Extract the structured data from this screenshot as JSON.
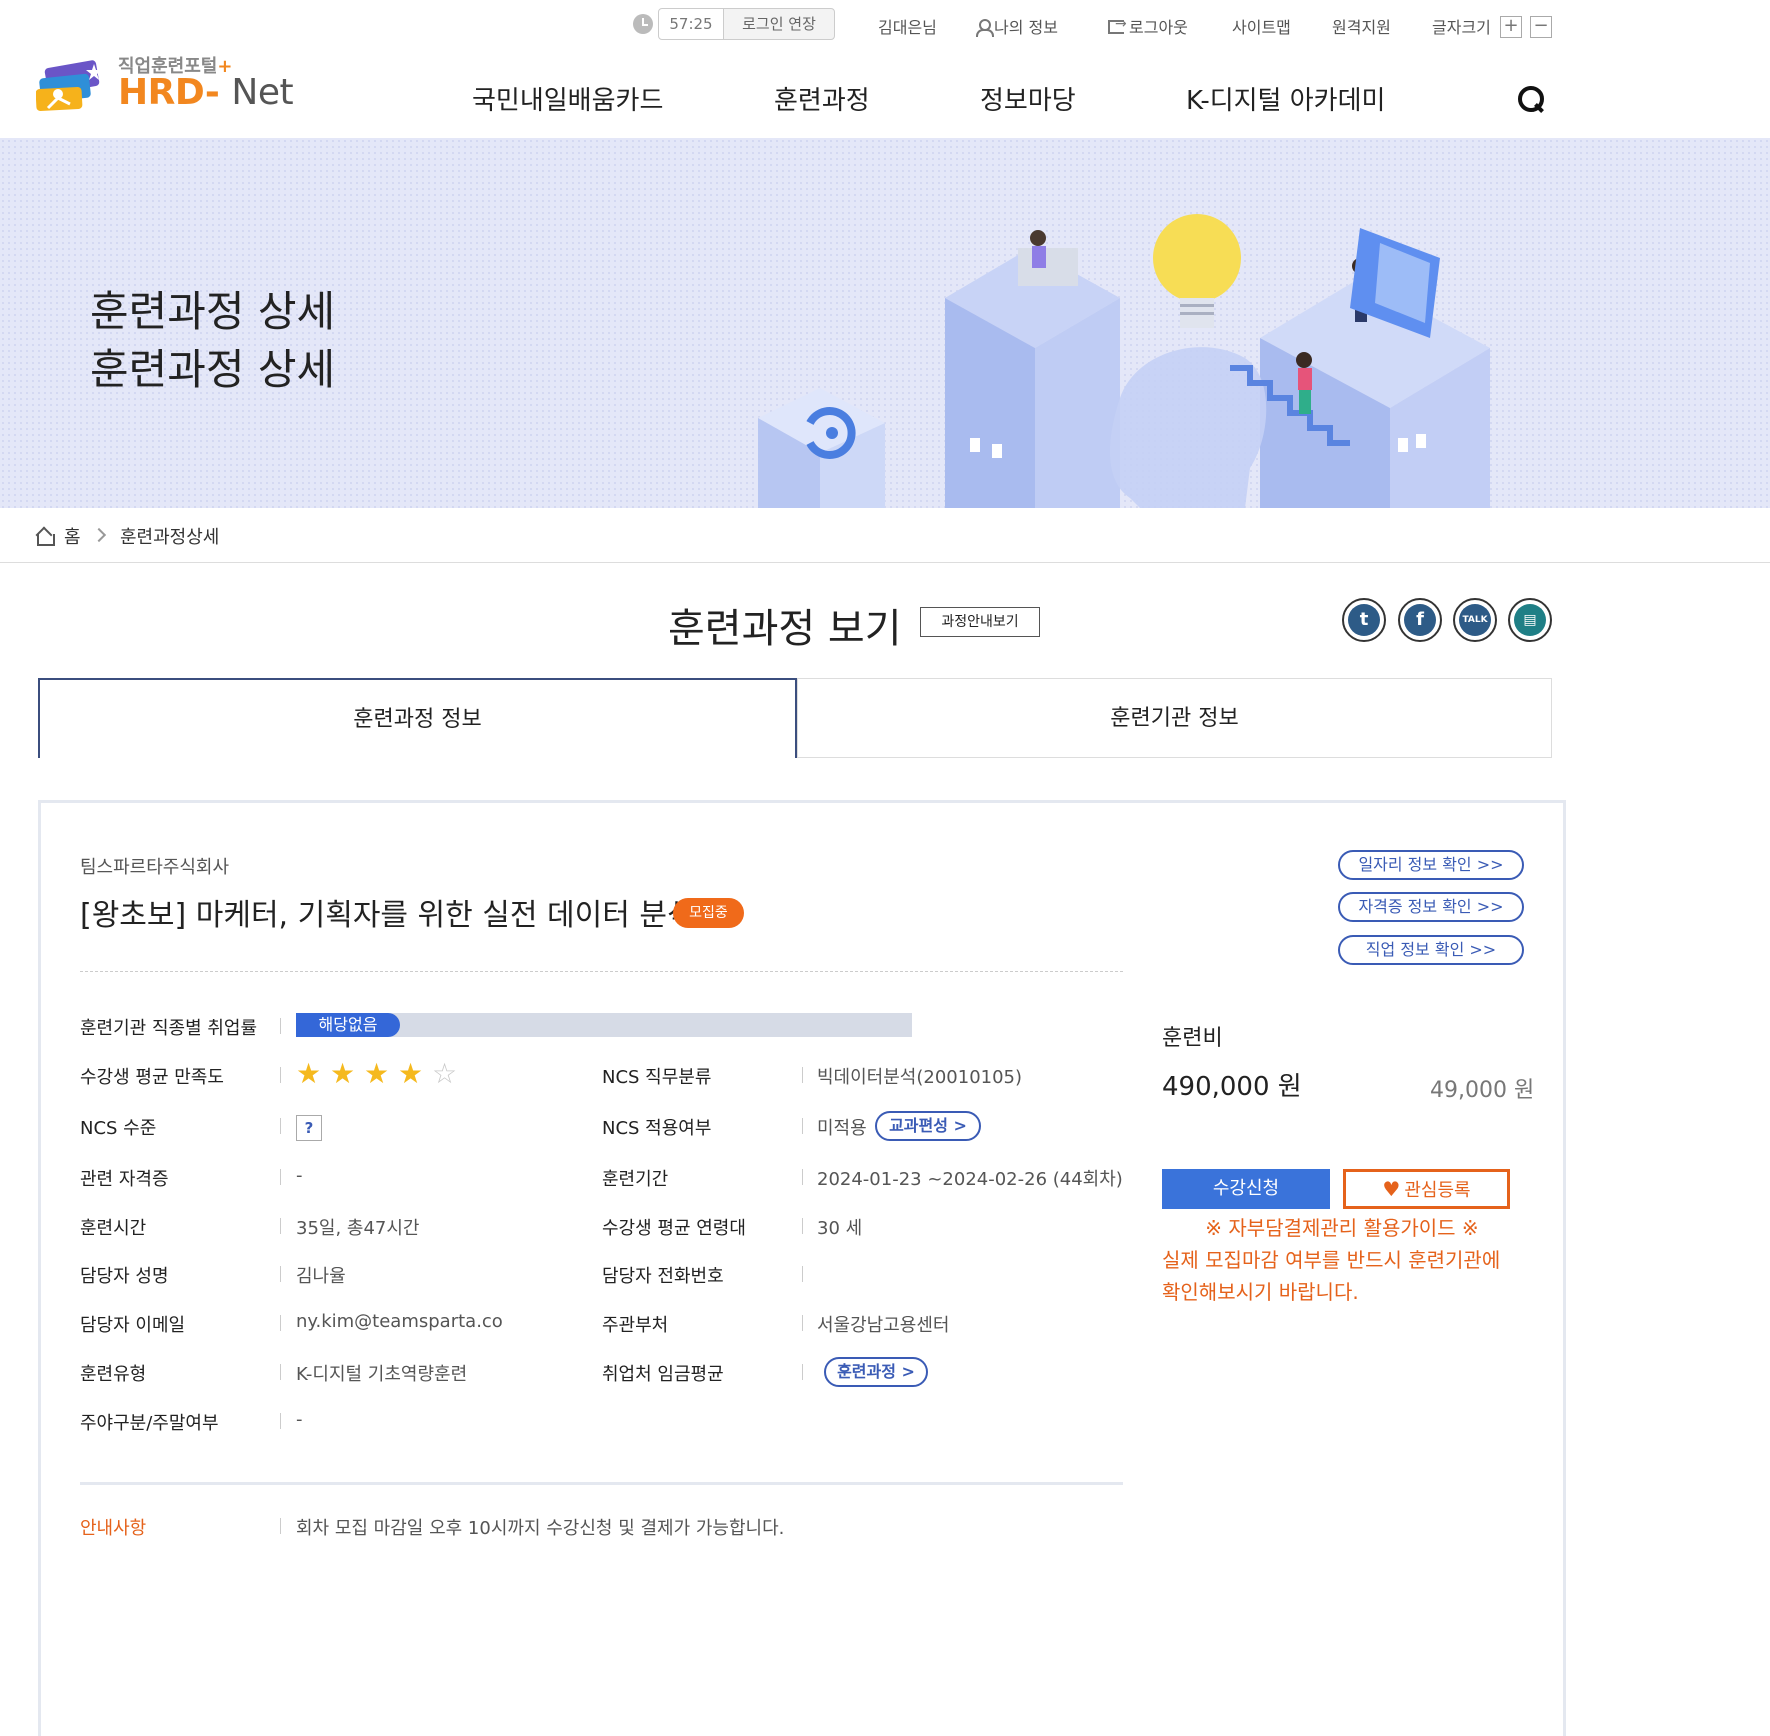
{
  "util": {
    "timer": "57:25",
    "extend": "로그인 연장",
    "user": "김대은님",
    "myinfo": "나의 정보",
    "logout": "로그아웃",
    "sitemap": "사이트맵",
    "remote": "원격지원",
    "fontsize": "글자크기",
    "font_plus": "+",
    "font_minus": "−"
  },
  "logo": {
    "sub": "직업훈련포털",
    "sub_plus": "+",
    "main_h": "HRD",
    "main_dash": "-",
    "main_n": "Net"
  },
  "nav": [
    "국민내일배움카드",
    "훈련과정",
    "정보마당",
    "K-디지털 아카데미"
  ],
  "banner": {
    "line1": "훈련과정 상세",
    "line2": "훈련과정 상세"
  },
  "breadcrumb": {
    "home": "홈",
    "current": "훈련과정상세"
  },
  "page": {
    "title": "훈련과정 보기",
    "guide_btn": "과정안내보기"
  },
  "sns": {
    "twitter": "t",
    "facebook": "f",
    "talk": "TALK",
    "print": "▤"
  },
  "tabs": [
    "훈련과정 정보",
    "훈련기관 정보"
  ],
  "course": {
    "org": "팀스파르타주식회사",
    "title": "[왕초보] 마케터, 기획자를 위한 실전 데이터 분석",
    "badge": "모집중"
  },
  "links": [
    "일자리 정보 확인 >>",
    "자격증 정보 확인 >>",
    "직업 정보 확인 >>"
  ],
  "details": {
    "emp_rate_label": "훈련기관 직종별 취업률",
    "emp_rate_value": "해당없음",
    "satisfaction_label": "수강생 평균 만족도",
    "satisfaction_stars": 4,
    "satisfaction_max": 5,
    "ncs_class_label": "NCS 직무분류",
    "ncs_class_value": "빅데이터분석(20010105)",
    "ncs_level_label": "NCS 수준",
    "ncs_level_icon": "?",
    "ncs_apply_label": "NCS 적용여부",
    "ncs_apply_value": "미적용",
    "ncs_apply_btn": "교과편성 >",
    "cert_label": "관련 자격증",
    "cert_value": "-",
    "period_label": "훈련기간",
    "period_value": "2024-01-23 ~2024-02-26 (44회차)",
    "hours_label": "훈련시간",
    "hours_value": "35일, 총47시간",
    "age_label": "수강생 평균 연령대",
    "age_value": "30 세",
    "manager_label": "담당자 성명",
    "manager_value": "김나율",
    "phone_label": "담당자 전화번호",
    "phone_value": "",
    "email_label": "담당자 이메일",
    "email_value": "ny.kim@teamsparta.co",
    "dept_label": "주관부처",
    "dept_value": "서울강남고용센터",
    "type_label": "훈련유형",
    "type_value": "K-디지털 기초역량훈련",
    "wage_label": "취업처 임금평균",
    "wage_btn": "훈련과정 >",
    "night_label": "주야구분/주말여부",
    "night_value": "-"
  },
  "fee": {
    "label": "훈련비",
    "value": "490,000 원",
    "self_pay": "49,000 원",
    "apply_btn": "수강신청",
    "fav_btn": "관심등록",
    "notice_title": "※ 자부담결제관리 활용가이드 ※",
    "notice_body": "실제 모집마감 여부를 반드시 훈련기관에 확인해보시기 바랍니다."
  },
  "info": {
    "label": "안내사항",
    "value": "회차 모집 마감일 오후 10시까지 수강신청 및 결제가 가능합니다."
  },
  "colors": {
    "accent": "#3a5bb5",
    "orange": "#e5621b",
    "brand": "#f2871f",
    "apply": "#3a73da"
  }
}
